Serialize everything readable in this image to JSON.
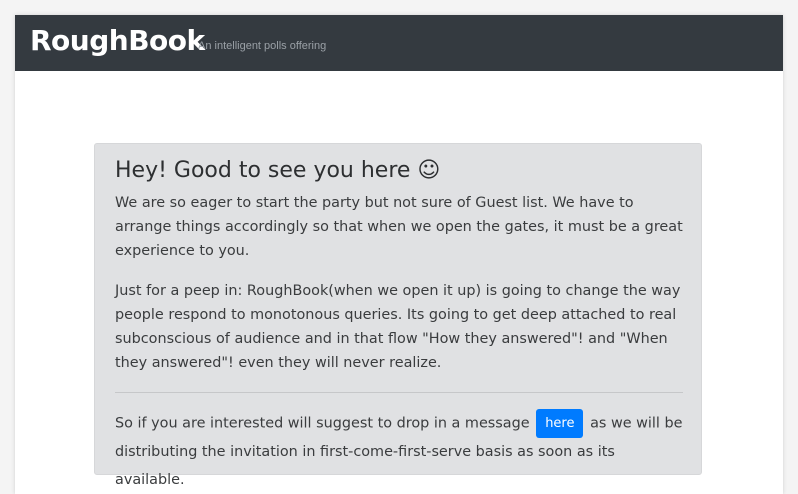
{
  "navbar": {
    "brand": "RoughBook",
    "tagline": "An intelligent polls offering"
  },
  "jumbotron": {
    "heading": "Hey! Good to see you here ☺",
    "paragraph_1": "We are so eager to start the party but not sure of Guest list. We have to arrange things accordingly so that when we open the gates, it must be a great experience to you.",
    "paragraph_2": "Just for a peep in: RoughBook(when we open it up) is going to change the way people respond to monotonous queries. Its going to get deep attached to real subconscious of audience and in that flow \"How they answered\"! and \"When they answered\"! even they will never realize.",
    "cta_before": "So if you are interested will suggest to drop in a message",
    "cta_button": "here",
    "cta_after": "as we will be distributing the invitation in first-come-first-serve basis as soon as its available."
  },
  "colors": {
    "navbar_bg": "#343a40",
    "jumbotron_bg": "#e0e1e3",
    "button_bg": "#007bff"
  }
}
